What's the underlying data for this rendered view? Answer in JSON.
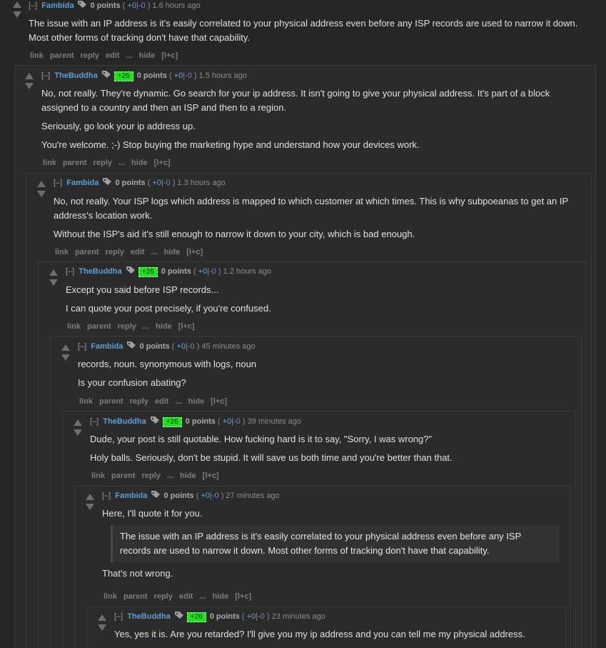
{
  "colors": {
    "author": "#5d9fd6",
    "flair_bg": "#22dd22",
    "background": "#262626"
  },
  "common": {
    "collapse": "[–]",
    "points": "0 points",
    "open_paren": "(",
    "plus": "+0",
    "sep": "|",
    "minus": "-0",
    "close_paren": ")",
    "flair": "+26",
    "link": "link",
    "parent": "parent",
    "reply": "reply",
    "edit": "edit",
    "more": "...",
    "hide": "hide",
    "collapse_tree": "[l+c]"
  },
  "comments": [
    {
      "author": "Fambida",
      "time": "1.6 hours ago",
      "paras": [
        "The issue with an IP address is it's easily correlated to your physical address even before any ISP records are used to narrow it down. Most other forms of tracking don't have that capability."
      ]
    },
    {
      "author": "TheBuddha",
      "time": "1.5 hours ago",
      "paras": [
        "No, not really. They're dynamic. Go search for your ip address. It isn't going to give your physical address. It's part of a block assigned to a country and then an ISP and then to a region.",
        "Seriously, go look your ip address up.",
        "You're welcome. ;-) Stop buying the marketing hype and understand how your devices work."
      ]
    },
    {
      "author": "Fambida",
      "time": "1.3 hours ago",
      "paras": [
        "No, not really. Your ISP logs which address is mapped to which customer at which times. This is why subpoeanas to get an IP address's location work.",
        "Without the ISP's aid it's still enough to narrow it down to your city, which is bad enough."
      ]
    },
    {
      "author": "TheBuddha",
      "time": "1.2 hours ago",
      "paras": [
        "Except you said before ISP records...",
        "I can quote your post precisely, if you're confused."
      ]
    },
    {
      "author": "Fambida",
      "time": "45 minutes ago",
      "paras": [
        "records, noun. synonymous with logs, noun",
        "Is your confusion abating?"
      ]
    },
    {
      "author": "TheBuddha",
      "time": "39 minutes ago",
      "paras": [
        "Dude, your post is still quotable. How fucking hard is it to say, \"Sorry, I was wrong?\"",
        "Holy balls. Seriously, don't be stupid. It will save us both time and you're better than that."
      ]
    },
    {
      "author": "Fambida",
      "time": "27 minutes ago",
      "paras": [
        "Here, I'll quote it for you."
      ],
      "quote": "The issue with an IP address is it's easily correlated to your physical address even before any ISP records are used to narrow it down. Most other forms of tracking don't have that capability.",
      "after": "That's not wrong."
    },
    {
      "author": "TheBuddha",
      "time": "23 minutes ago",
      "paras": [
        "Yes, yes it is. Are you retarded? I'll give you my ip address and you can tell me my physical address."
      ]
    }
  ]
}
